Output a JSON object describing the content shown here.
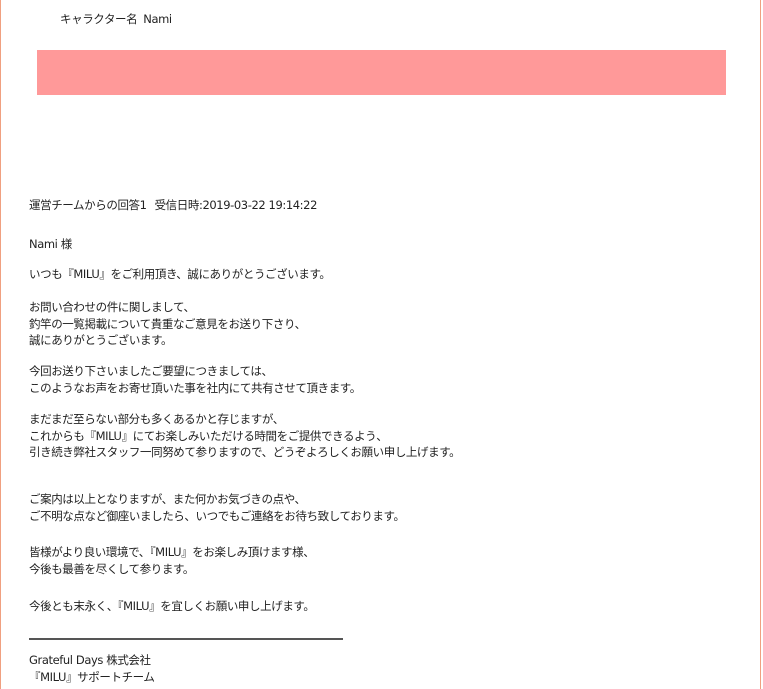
{
  "character": {
    "label": "キャラクター名",
    "value": "Nami"
  },
  "colors": {
    "banner": "#ff9999",
    "border": "#f0a080"
  },
  "reply": {
    "title": "運営チームからの回答1",
    "received": "受信日時:2019-03-22 19:14:22"
  },
  "message": {
    "greeting": "Nami 様",
    "p1": [
      "いつも『MILU』をご利用頂き、誠にありがとうございます。"
    ],
    "p2": [
      "お問い合わせの件に関しまして、",
      "釣竿の一覧掲載について貴重なご意見をお送り下さり、",
      "誠にありがとうございます。"
    ],
    "p3": [
      "今回お送り下さいましたご要望につきましては、",
      "このようなお声をお寄せ頂いた事を社内にて共有させて頂きます。"
    ],
    "p4": [
      "まだまだ至らない部分も多くあるかと存じますが、",
      "これからも『MILU』にてお楽しみいただける時間をご提供できるよう、",
      "引き続き弊社スタッフ一同努めて参りますので、どうぞよろしくお願い申し上げます。"
    ],
    "p5": [
      "ご案内は以上となりますが、また何かお気づきの点や、",
      "ご不明な点など御座いましたら、いつでもご連絡をお待ち致しております。"
    ],
    "p6": [
      "皆様がより良い環境で、『MILU』をお楽しみ頂けます様、",
      "今後も最善を尽くして参ります。"
    ],
    "p7": [
      "今後とも末永く、『MILU』を宜しくお願い申し上げます。"
    ]
  },
  "signature": {
    "company": "Grateful Days 株式会社",
    "team": "『MILU』サポートチーム"
  }
}
